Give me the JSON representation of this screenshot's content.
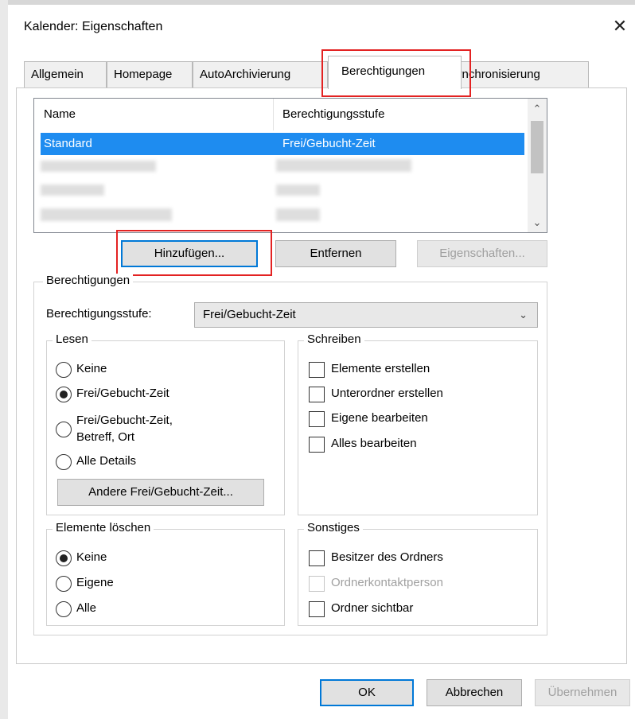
{
  "window": {
    "title": "Kalender: Eigenschaften"
  },
  "tabs": [
    {
      "label": "Allgemein"
    },
    {
      "label": "Homepage"
    },
    {
      "label": "AutoArchivierung"
    },
    {
      "label": "Berechtigungen"
    },
    {
      "label": "Synchronisierung"
    }
  ],
  "list": {
    "headers": {
      "name": "Name",
      "level": "Berechtigungsstufe"
    },
    "selected_row": {
      "name": "Standard",
      "level": "Frei/Gebucht-Zeit"
    }
  },
  "list_buttons": {
    "add": "Hinzufügen...",
    "remove": "Entfernen",
    "properties": "Eigenschaften..."
  },
  "permissions": {
    "label": "Berechtigungen",
    "level_label": "Berechtigungsstufe:",
    "level_value": "Frei/Gebucht-Zeit",
    "read": {
      "label": "Lesen",
      "options": [
        "Keine",
        "Frei/Gebucht-Zeit",
        "Frei/Gebucht-Zeit,",
        "Betreff, Ort",
        "Alle Details"
      ],
      "other_button": "Andere Frei/Gebucht-Zeit..."
    },
    "write": {
      "label": "Schreiben",
      "options": [
        "Elemente erstellen",
        "Unterordner erstellen",
        "Eigene bearbeiten",
        "Alles bearbeiten"
      ]
    },
    "delete": {
      "label": "Elemente löschen",
      "options": [
        "Keine",
        "Eigene",
        "Alle"
      ]
    },
    "other": {
      "label": "Sonstiges",
      "options": [
        "Besitzer des Ordners",
        "Ordnerkontaktperson",
        "Ordner sichtbar"
      ]
    }
  },
  "footer": {
    "ok": "OK",
    "cancel": "Abbrechen",
    "apply": "Übernehmen"
  }
}
